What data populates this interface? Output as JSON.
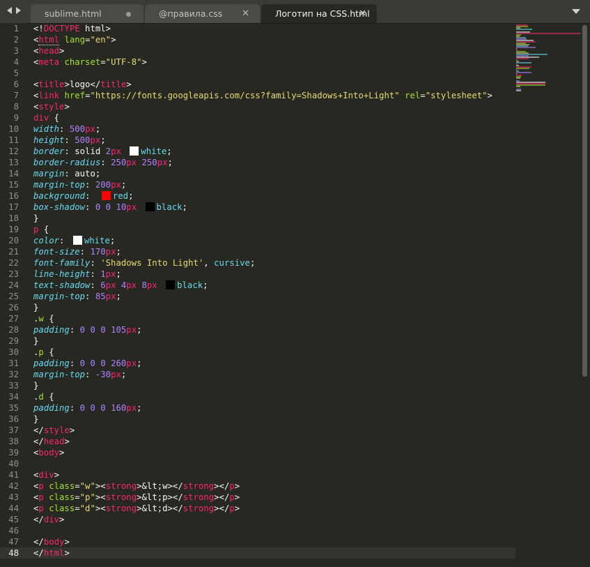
{
  "tabs": [
    {
      "label": "sublime.html",
      "state": "dirty"
    },
    {
      "label": "@правила.css",
      "state": "close"
    },
    {
      "label": "Логотип на CSS.html",
      "state": "close",
      "active": true
    }
  ],
  "current_line": 48,
  "colors": {
    "background": "#272822",
    "tag": "#f92672",
    "attribute": "#a6e22e",
    "string": "#e6db74",
    "number": "#ae81ff",
    "property": "#66d9ef",
    "text": "#f8f8f2",
    "swatch_white": "#ffffff",
    "swatch_red": "#ff0000",
    "swatch_black": "#000000"
  },
  "lines": [
    "<!DOCTYPE html>",
    "<html lang=\"en\">",
    "<head>",
    "<meta charset=\"UTF-8\">",
    "",
    "<title>logo</title>",
    "<link href=\"https://fonts.googleapis.com/css?family=Shadows+Into+Light\" rel=\"stylesheet\">",
    "<style>",
    "div {",
    "width: 500px;",
    "height: 500px;",
    "border: solid 2px white;",
    "border-radius: 250px 250px;",
    "margin: auto;",
    "margin-top: 200px;",
    "background: red;",
    "box-shadow: 0 0 10px black;",
    "}",
    "p {",
    "color: white;",
    "font-size: 170px;",
    "font-family: 'Shadows Into Light', cursive;",
    "line-height: 1px;",
    "text-shadow: 6px 4px 8px black;",
    "margin-top: 85px;",
    "}",
    ".w {",
    "padding: 0 0 0 105px;",
    "}",
    ".p {",
    "padding: 0 0 0 260px;",
    "margin-top: -30px;",
    "}",
    ".d {",
    "padding: 0 0 0 160px;",
    "}",
    "</style>",
    "</head>",
    "<body>",
    "",
    "<div>",
    "<p class=\"w\"><strong>&lt;w></strong></p>",
    "<p class=\"p\"><strong>&lt;p></strong></p>",
    "<p class=\"d\"><strong>&lt;d></strong></p>",
    "</div>",
    "",
    "</body>",
    "</html>"
  ]
}
